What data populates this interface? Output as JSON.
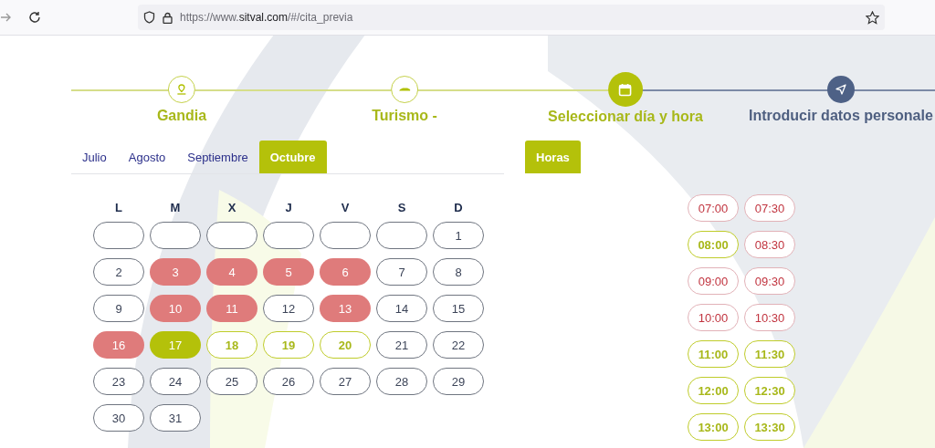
{
  "browser": {
    "url": "https://www.**sitval.com**/#/cita_previa"
  },
  "steps": [
    {
      "label": "Gandia",
      "kind": "done"
    },
    {
      "label": "Turismo -",
      "kind": "done"
    },
    {
      "label": "Seleccionar día y hora",
      "kind": "current"
    },
    {
      "label": "Introducir datos personale",
      "kind": "pending"
    }
  ],
  "month_tabs": [
    {
      "label": "Julio",
      "selected": false
    },
    {
      "label": "Agosto",
      "selected": false
    },
    {
      "label": "Septiembre",
      "selected": false
    },
    {
      "label": "Octubre",
      "selected": true
    }
  ],
  "hours_tab": {
    "label": "Horas",
    "selected": true
  },
  "weekdays": [
    "L",
    "M",
    "X",
    "J",
    "V",
    "S",
    "D"
  ],
  "days": [
    {
      "kind": "blank",
      "selected": false
    },
    {
      "kind": "blank",
      "selected": false
    },
    {
      "kind": "blank",
      "selected": false
    },
    {
      "kind": "blank",
      "selected": false
    },
    {
      "kind": "blank",
      "selected": false
    },
    {
      "kind": "blank",
      "selected": false
    },
    {
      "label": "1",
      "kind": "closed",
      "selected": false
    },
    {
      "label": "2",
      "kind": "closed",
      "selected": false
    },
    {
      "label": "3",
      "kind": "full",
      "selected": false
    },
    {
      "label": "4",
      "kind": "full",
      "selected": false
    },
    {
      "label": "5",
      "kind": "full",
      "selected": false
    },
    {
      "label": "6",
      "kind": "full",
      "selected": false
    },
    {
      "label": "7",
      "kind": "closed",
      "selected": false
    },
    {
      "label": "8",
      "kind": "closed",
      "selected": false
    },
    {
      "label": "9",
      "kind": "closed",
      "selected": false
    },
    {
      "label": "10",
      "kind": "full",
      "selected": false
    },
    {
      "label": "11",
      "kind": "full",
      "selected": false
    },
    {
      "label": "12",
      "kind": "closed",
      "selected": false
    },
    {
      "label": "13",
      "kind": "full",
      "selected": false
    },
    {
      "label": "14",
      "kind": "closed",
      "selected": false
    },
    {
      "label": "15",
      "kind": "closed",
      "selected": false
    },
    {
      "label": "16",
      "kind": "full",
      "selected": false
    },
    {
      "label": "17",
      "kind": "available",
      "selected": true
    },
    {
      "label": "18",
      "kind": "available",
      "selected": false
    },
    {
      "label": "19",
      "kind": "available",
      "selected": false
    },
    {
      "label": "20",
      "kind": "available",
      "selected": false
    },
    {
      "label": "21",
      "kind": "closed",
      "selected": false
    },
    {
      "label": "22",
      "kind": "closed",
      "selected": false
    },
    {
      "label": "23",
      "kind": "closed",
      "selected": false
    },
    {
      "label": "24",
      "kind": "closed",
      "selected": false
    },
    {
      "label": "25",
      "kind": "closed",
      "selected": false
    },
    {
      "label": "26",
      "kind": "closed",
      "selected": false
    },
    {
      "label": "27",
      "kind": "closed",
      "selected": false
    },
    {
      "label": "28",
      "kind": "closed",
      "selected": false
    },
    {
      "label": "29",
      "kind": "closed",
      "selected": false
    },
    {
      "label": "30",
      "kind": "closed",
      "selected": false
    },
    {
      "label": "31",
      "kind": "closed",
      "selected": false
    }
  ],
  "times": [
    {
      "label": "07:00",
      "kind": "full"
    },
    {
      "label": "07:30",
      "kind": "full"
    },
    {
      "label": "08:00",
      "kind": "available"
    },
    {
      "label": "08:30",
      "kind": "full"
    },
    {
      "label": "09:00",
      "kind": "full"
    },
    {
      "label": "09:30",
      "kind": "full"
    },
    {
      "label": "10:00",
      "kind": "full"
    },
    {
      "label": "10:30",
      "kind": "full"
    },
    {
      "label": "11:00",
      "kind": "available"
    },
    {
      "label": "11:30",
      "kind": "available"
    },
    {
      "label": "12:00",
      "kind": "available"
    },
    {
      "label": "12:30",
      "kind": "available"
    },
    {
      "label": "13:00",
      "kind": "available"
    },
    {
      "label": "13:30",
      "kind": "available"
    }
  ]
}
